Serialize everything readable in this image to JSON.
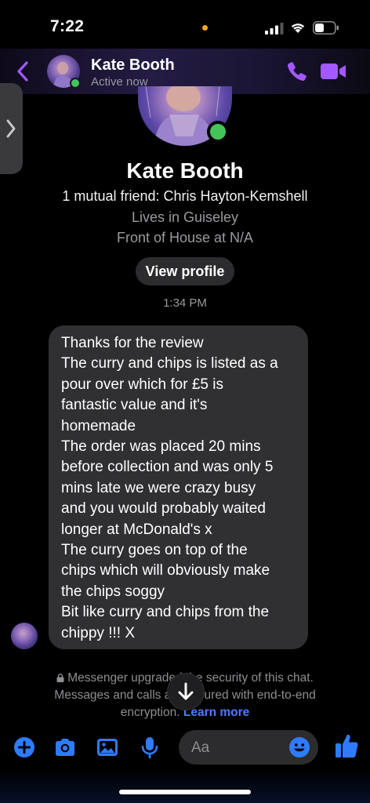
{
  "status_bar": {
    "time": "7:22",
    "icons": [
      "signal-icon",
      "wifi-icon",
      "battery-icon"
    ]
  },
  "header": {
    "contact_name": "Kate Booth",
    "status": "Active now",
    "icons": [
      "back-chevron-icon",
      "phone-icon",
      "video-camera-icon"
    ],
    "accent_color": "#a259ff"
  },
  "profile": {
    "name": "Kate Booth",
    "mutual": "1 mutual friend: Chris Hayton-Kemshell",
    "location": "Lives in Guiseley",
    "work": "Front of House at N/A",
    "view_profile_label": "View profile",
    "online_color": "#43c35a"
  },
  "conversation": {
    "timestamp": "1:34 PM",
    "message_lines": [
      "Thanks for the review",
      "The curry and chips is listed as a",
      "pour over which for £5 is",
      "fantastic value and it's",
      "homemade",
      "The order was placed 20 mins",
      "before collection and was only 5",
      "mins late we were crazy busy",
      "and you would probably waited",
      "longer at McDonald's x",
      "The curry goes on top of the",
      "chips which will obviously make",
      "the chips soggy",
      "Bit like curry and chips from the",
      "chippy !!! X"
    ]
  },
  "encryption_notice": {
    "line1": "Messenger upgraded the security of this chat.",
    "line2": "Messages and calls are secured with end-to-end",
    "line3_text": "encryption.",
    "learn_more": "Learn more",
    "link_color": "#4d7cff"
  },
  "composer": {
    "placeholder": "Aa",
    "tools": [
      "plus-icon",
      "camera-icon",
      "image-icon",
      "microphone-icon"
    ],
    "accent_color": "#2f7bff"
  }
}
